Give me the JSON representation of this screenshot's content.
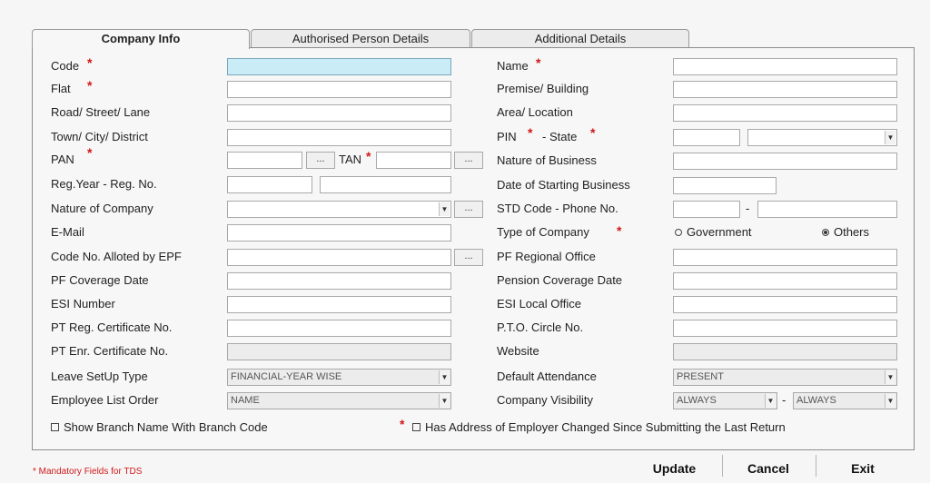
{
  "tabs": [
    {
      "label": "Company Info"
    },
    {
      "label": "Authorised Person Details"
    },
    {
      "label": "Additional Details"
    }
  ],
  "left": {
    "code": "Code",
    "flat": "Flat",
    "road": "Road/ Street/ Lane",
    "town": "Town/ City/ District",
    "pan": "PAN",
    "tan": "TAN",
    "reg": "Reg.Year - Reg. No.",
    "nature_company": "Nature of Company",
    "email": "E-Mail",
    "code_epf": "Code No. Alloted by EPF",
    "pf_cov": "PF Coverage Date",
    "esi_num": "ESI Number",
    "pt_reg": "PT Reg. Certificate No.",
    "pt_enr": "PT Enr. Certificate No.",
    "leave_setup": "Leave SetUp Type",
    "emp_order": "Employee List Order"
  },
  "right": {
    "name": "Name",
    "premise": "Premise/ Building",
    "area": "Area/ Location",
    "pin": "PIN",
    "state": "- State",
    "nature_business": "Nature of Business",
    "date_start": "Date of Starting Business",
    "std_phone": "STD Code - Phone No.",
    "type_company": "Type of Company",
    "pf_regional": "PF Regional Office",
    "pension_cov": "Pension Coverage Date",
    "esi_local": "ESI Local Office",
    "pto": "P.T.O. Circle No.",
    "website": "Website",
    "default_att": "Default Attendance",
    "company_vis": "Company Visibility"
  },
  "selects": {
    "leave_setup": "FINANCIAL-YEAR WISE",
    "emp_order": "NAME",
    "default_att": "PRESENT",
    "vis1": "ALWAYS",
    "vis2": "ALWAYS"
  },
  "radios": {
    "government": "Government",
    "others": "Others"
  },
  "checks": {
    "branch": "Show Branch Name With Branch Code",
    "address": "Has Address of Employer Changed Since Submitting the Last Return"
  },
  "misc": {
    "dots": "...",
    "dash": "-",
    "star": "*"
  },
  "buttons": {
    "update": "Update",
    "cancel": "Cancel",
    "exit": "Exit"
  },
  "footer": "* Mandatory Fields for TDS"
}
